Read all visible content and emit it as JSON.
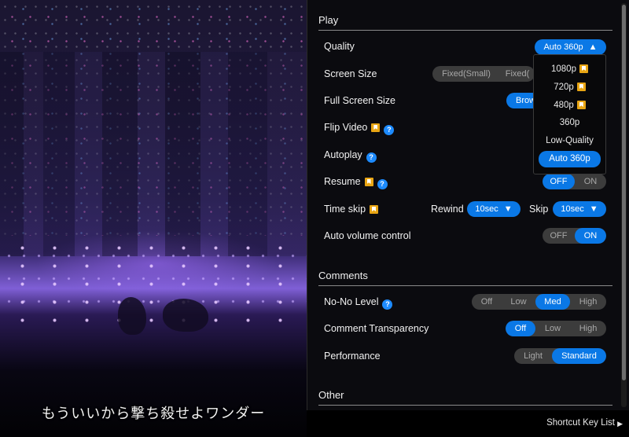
{
  "video": {
    "subtitle": "もういいから撃ち殺せよワンダー"
  },
  "settings": {
    "sections": {
      "play": "Play",
      "comments": "Comments",
      "other": "Other"
    },
    "quality": {
      "label": "Quality",
      "value": "Auto 360p",
      "arrow": "▲",
      "options": [
        {
          "label": "1080p",
          "premium": true
        },
        {
          "label": "720p",
          "premium": true
        },
        {
          "label": "480p",
          "premium": true
        },
        {
          "label": "360p",
          "premium": false
        },
        {
          "label": "Low-Quality",
          "premium": false
        },
        {
          "label": "Auto 360p",
          "premium": false,
          "selected": true
        }
      ]
    },
    "screen_size": {
      "label": "Screen Size",
      "options": [
        "Fixed(Small)",
        "Fixed("
      ]
    },
    "full_screen_size": {
      "label": "Full Screen Size",
      "selected": "Brow"
    },
    "flip_video": {
      "label": "Flip Video"
    },
    "autoplay": {
      "label": "Autoplay"
    },
    "resume": {
      "label": "Resume",
      "off": "OFF",
      "on": "ON",
      "selected": "OFF"
    },
    "time_skip": {
      "label": "Time skip",
      "rewind_label": "Rewind",
      "rewind_value": "10sec",
      "skip_label": "Skip",
      "skip_value": "10sec",
      "arrow": "▼"
    },
    "auto_volume": {
      "label": "Auto volume control",
      "off": "OFF",
      "on": "ON",
      "selected": "ON"
    },
    "no_no_level": {
      "label": "No-No Level",
      "options": [
        "Off",
        "Low",
        "Med",
        "High"
      ],
      "selected": "Med"
    },
    "comment_transparency": {
      "label": "Comment Transparency",
      "options": [
        "Off",
        "Low",
        "High"
      ],
      "selected": "Off"
    },
    "performance": {
      "label": "Performance",
      "options": [
        "Light",
        "Standard"
      ],
      "selected": "Standard"
    }
  },
  "footer": {
    "shortcut_label": "Shortcut Key List",
    "shortcut_arrow": "▶"
  },
  "colors": {
    "accent": "#0a78e6",
    "premium": "#e8a514",
    "help": "#1d8bff"
  },
  "icons": {
    "premium": "premium-bookmark-icon",
    "help": "help-icon",
    "dropdown": "triangle-icon",
    "chevron": "chevron-right-icon"
  }
}
